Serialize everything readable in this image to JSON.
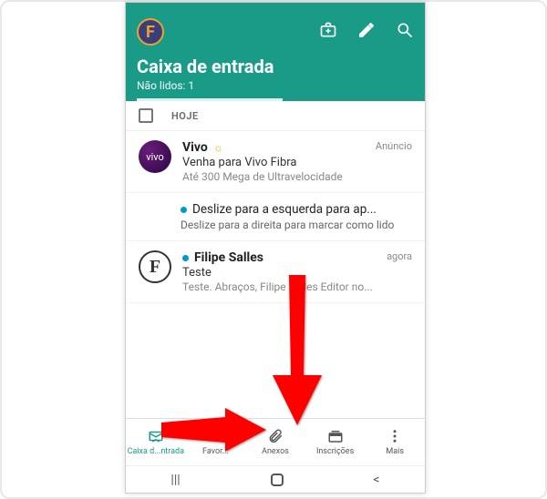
{
  "header": {
    "title": "Caixa de entrada",
    "unread_label": "Não lidos: 1"
  },
  "section": {
    "label": "HOJE"
  },
  "mails": {
    "ad_label": "Anúncio",
    "vivo": {
      "sender": "Vivo",
      "subject": "Venha para Vivo Fibra",
      "preview": "Até 300 Mega de Ultravelocidade"
    },
    "tip": {
      "title": "Deslize para a esquerda para ap...",
      "subtitle": "Deslize para a direita para marcar como lido"
    },
    "filipe": {
      "sender": "Filipe Salles",
      "subject": "Teste",
      "preview": "Teste. Abraços, Filipe Salles Editor no...",
      "time": "agora",
      "avatar_letter": "F"
    }
  },
  "nav": {
    "inbox": "Caixa d...ntrada",
    "fav": "Favor...",
    "attach": "Anexos",
    "subs": "Inscrições",
    "more": "Mais"
  }
}
